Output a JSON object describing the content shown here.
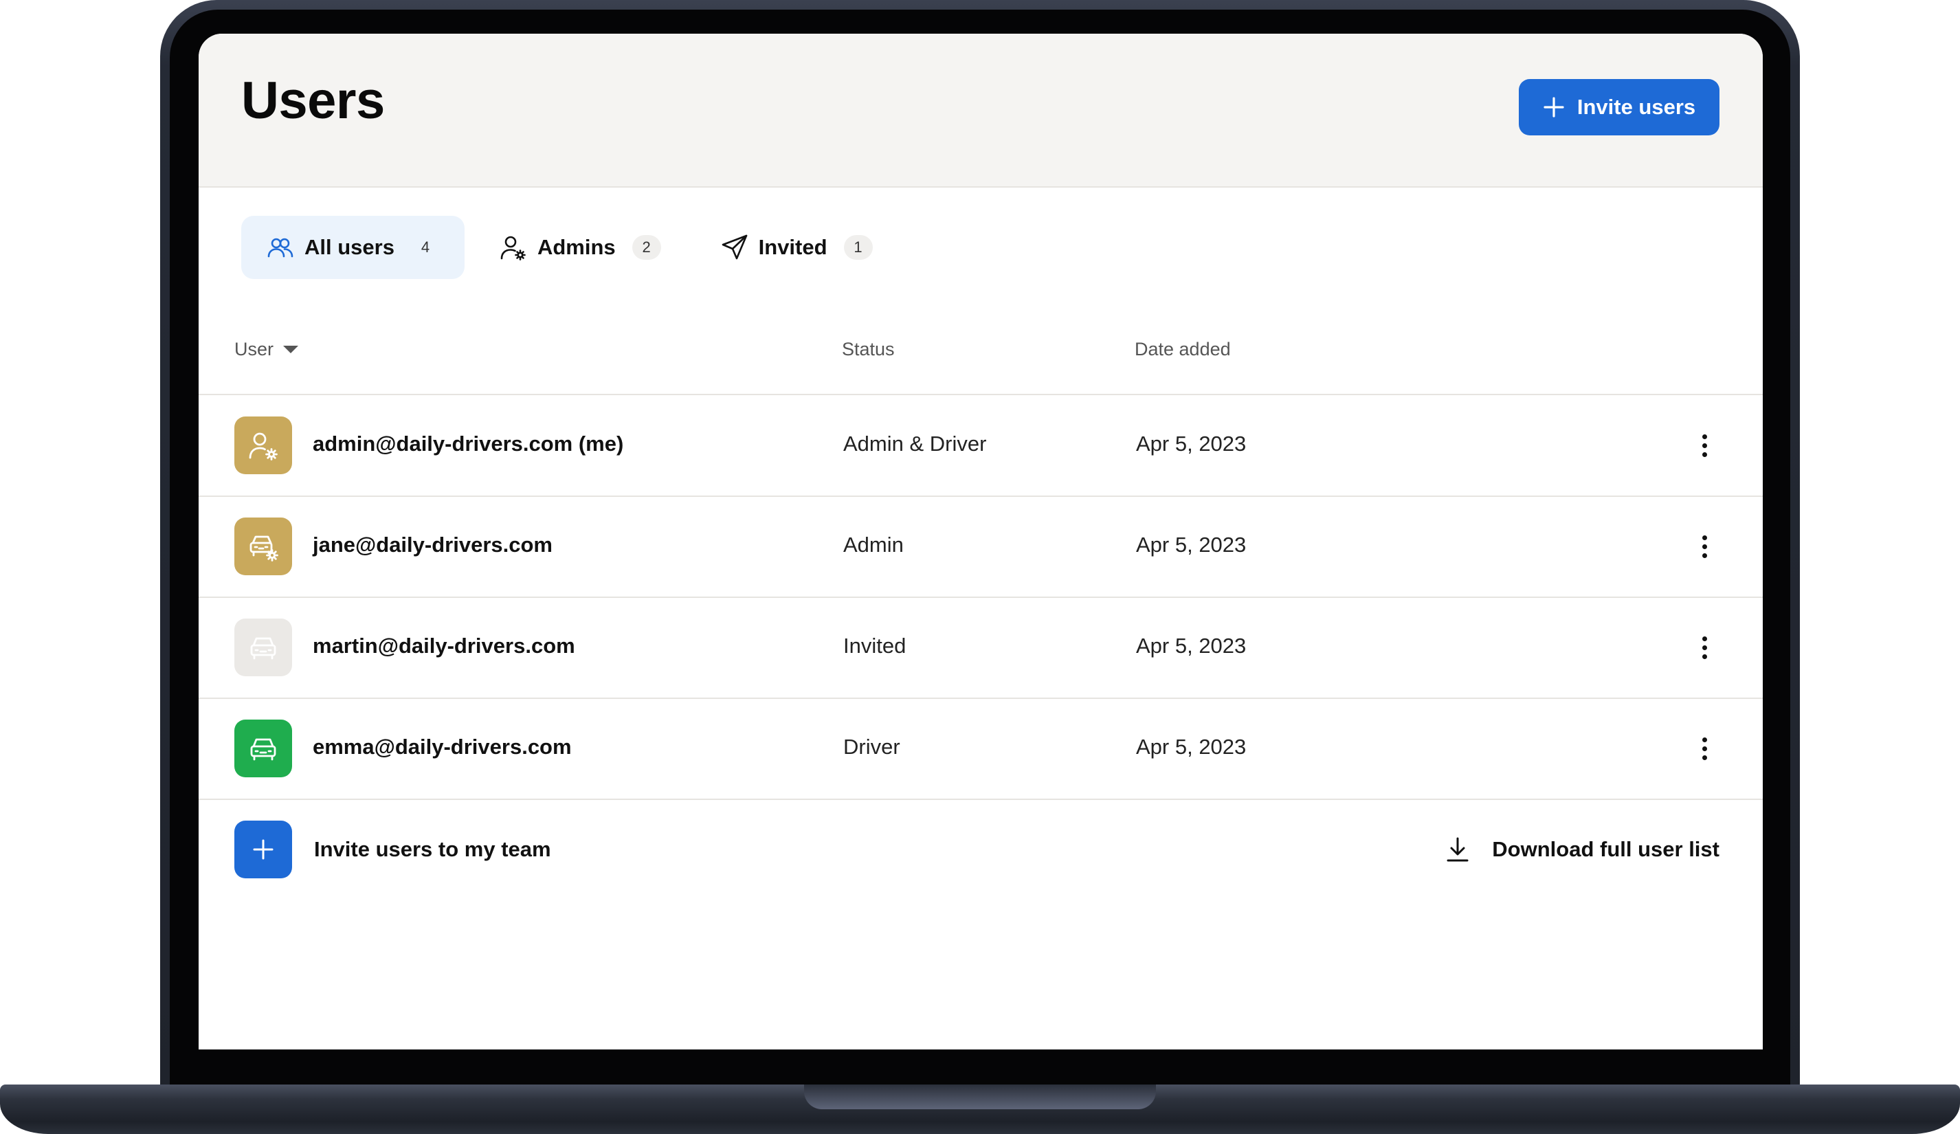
{
  "header": {
    "title": "Users",
    "invite_button": "Invite users"
  },
  "tabs": [
    {
      "label": "All users",
      "count": "4",
      "icon": "users-icon",
      "active": true
    },
    {
      "label": "Admins",
      "count": "2",
      "icon": "user-gear-icon",
      "active": false
    },
    {
      "label": "Invited",
      "count": "1",
      "icon": "send-icon",
      "active": false
    }
  ],
  "table": {
    "columns": {
      "user": "User",
      "status": "Status",
      "date": "Date added"
    },
    "rows": [
      {
        "email": "admin@daily-drivers.com (me)",
        "status": "Admin & Driver",
        "date": "Apr 5, 2023",
        "avatar_icon": "user-gear-icon",
        "avatar_color": "#c9a95c"
      },
      {
        "email": "jane@daily-drivers.com",
        "status": "Admin",
        "date": "Apr 5, 2023",
        "avatar_icon": "car-gear-icon",
        "avatar_color": "#c9a95c"
      },
      {
        "email": "martin@daily-drivers.com",
        "status": "Invited",
        "date": "Apr 5, 2023",
        "avatar_icon": "car-icon",
        "avatar_color": "#ebe9e6"
      },
      {
        "email": "emma@daily-drivers.com",
        "status": "Driver",
        "date": "Apr 5, 2023",
        "avatar_icon": "car-icon",
        "avatar_color": "#1fad4e"
      }
    ]
  },
  "footer": {
    "invite_label": "Invite users to my team",
    "download_label": "Download full user list"
  },
  "colors": {
    "primary": "#1e6ad6",
    "header_bg": "#f5f4f2",
    "active_tab_bg": "#ebf3fc",
    "admin_avatar": "#c9a95c",
    "driver_avatar": "#1fad4e",
    "invited_avatar": "#ebe9e6"
  }
}
